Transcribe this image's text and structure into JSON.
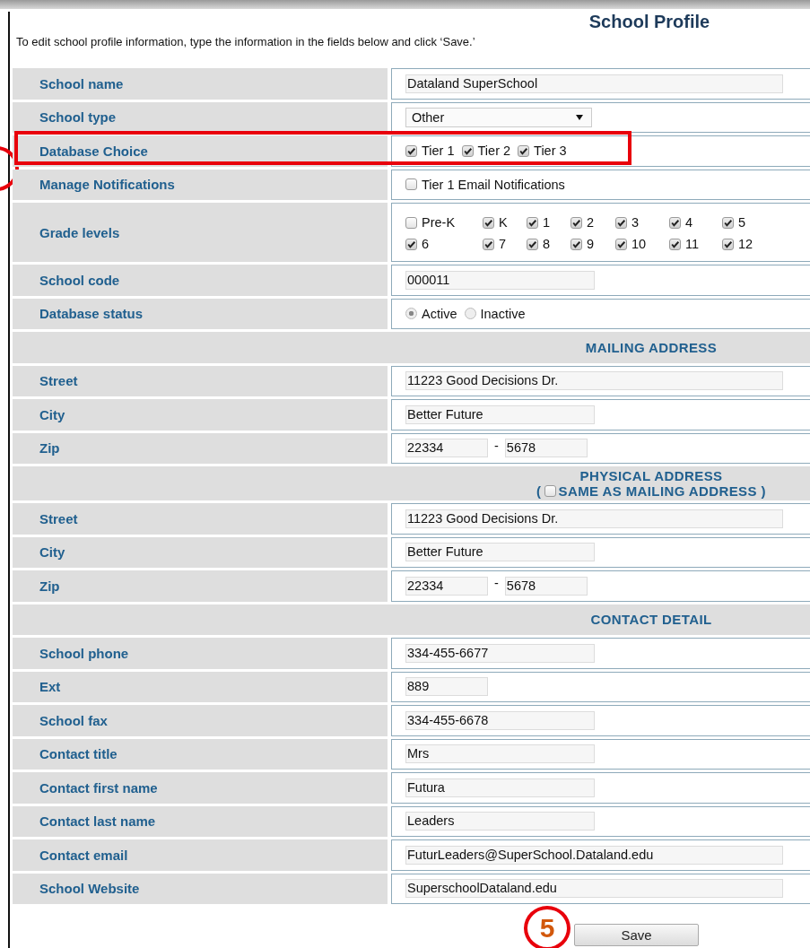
{
  "title": "School Profile",
  "instructions": "To edit school profile information, type the information in the fields below and click ‘Save.’",
  "rows": [
    {
      "kind": "long-text",
      "label": "School name",
      "value": "Dataland SuperSchool"
    },
    {
      "kind": "select",
      "label": "School type",
      "value": "Other"
    },
    {
      "kind": "checks",
      "label": "Database Choice",
      "highlighted": true,
      "options": [
        {
          "label": "Tier 1",
          "checked": true
        },
        {
          "label": "Tier 2",
          "checked": true
        },
        {
          "label": "Tier 3",
          "checked": true
        }
      ]
    },
    {
      "kind": "checks",
      "label": "Manage Notifications",
      "highlighted": false,
      "options": [
        {
          "label": "Tier 1 Email Notifications",
          "checked": false
        }
      ]
    },
    {
      "kind": "grid",
      "label": "Grade levels",
      "options": [
        {
          "label": "Pre-K",
          "checked": false
        },
        {
          "label": "K",
          "checked": true
        },
        {
          "label": "1",
          "checked": true
        },
        {
          "label": "2",
          "checked": true
        },
        {
          "label": "3",
          "checked": true
        },
        {
          "label": "4",
          "checked": true
        },
        {
          "label": "5",
          "checked": true
        },
        {
          "label": "6",
          "checked": true
        },
        {
          "label": "7",
          "checked": true
        },
        {
          "label": "8",
          "checked": true
        },
        {
          "label": "9",
          "checked": true
        },
        {
          "label": "10",
          "checked": true
        },
        {
          "label": "11",
          "checked": true
        },
        {
          "label": "12",
          "checked": true
        }
      ]
    },
    {
      "kind": "medium-text",
      "label": "School code",
      "value": "000011"
    },
    {
      "kind": "radios",
      "label": "Database status",
      "options": [
        {
          "label": "Active",
          "selected": true
        },
        {
          "label": "Inactive",
          "selected": false
        }
      ]
    },
    {
      "kind": "section",
      "title": "MAILING ADDRESS"
    },
    {
      "kind": "long-text",
      "label": "Street",
      "value": "11223 Good Decisions Dr."
    },
    {
      "kind": "medium-text",
      "label": "City",
      "value": "Better Future"
    },
    {
      "kind": "zip",
      "label": "Zip",
      "value": "22334",
      "dash": "-",
      "ext": "5678"
    },
    {
      "kind": "section",
      "title": "PHYSICAL ADDRESS",
      "note_open": "(",
      "note": "SAME AS MAILING ADDRESS )",
      "same_checked": false
    },
    {
      "kind": "long-text",
      "label": "Street",
      "value": "11223 Good Decisions Dr."
    },
    {
      "kind": "medium-text",
      "label": "City",
      "value": "Better Future"
    },
    {
      "kind": "zip",
      "label": "Zip",
      "value": "22334",
      "dash": "-",
      "ext": "5678"
    },
    {
      "kind": "section",
      "title": "CONTACT DETAIL"
    },
    {
      "kind": "medium-text",
      "label": "School phone",
      "value": "334-455-6677"
    },
    {
      "kind": "short-text",
      "label": "Ext",
      "value": "889"
    },
    {
      "kind": "medium-text",
      "label": "School fax",
      "value": "334-455-6678"
    },
    {
      "kind": "medium-text",
      "label": "Contact title",
      "value": "Mrs"
    },
    {
      "kind": "medium-text",
      "label": "Contact first name",
      "value": "Futura"
    },
    {
      "kind": "medium-text",
      "label": "Contact last name",
      "value": "Leaders"
    },
    {
      "kind": "long-text",
      "label": "Contact email",
      "value": "FuturLeaders@SuperSchool.Dataland.edu"
    },
    {
      "kind": "long-text",
      "label": "School Website",
      "value": "SuperschoolDataland.edu"
    }
  ],
  "save": "Save",
  "callout": "5"
}
